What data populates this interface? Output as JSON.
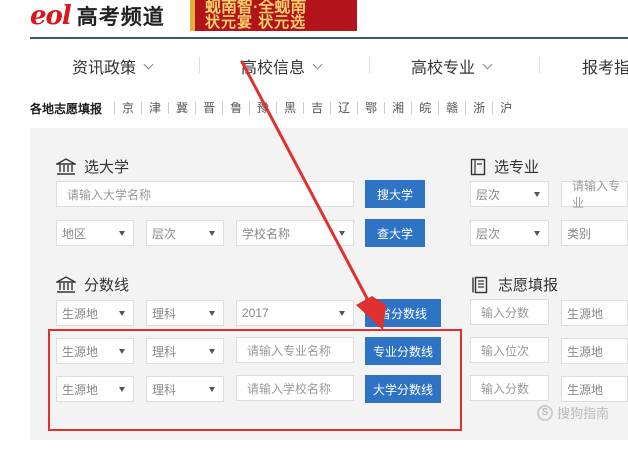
{
  "header": {
    "logo_mark": "eol",
    "logo_title": "高考频道",
    "banner_line1": "蚬南智·全蚬南",
    "banner_line2": "状元宴 状元选"
  },
  "nav": {
    "items": [
      "资讯政策",
      "高校信息",
      "高校专业",
      "报考指"
    ]
  },
  "provinces": {
    "title": "各地志愿填报",
    "items": [
      "京",
      "津",
      "冀",
      "晋",
      "鲁",
      "豫",
      "黑",
      "吉",
      "辽",
      "鄂",
      "湘",
      "皖",
      "赣",
      "浙",
      "沪"
    ]
  },
  "select_university": {
    "title": "选大学",
    "name_placeholder": "请输入大学名称",
    "search_button": "搜大学",
    "region": "地区",
    "level": "层次",
    "school_name": "学校名称",
    "find_button": "查大学"
  },
  "select_major": {
    "title": "选专业",
    "level1": "层次",
    "major_placeholder": "请输入专业",
    "level2": "层次",
    "category": "类别"
  },
  "score_line": {
    "title": "分数线",
    "rows": [
      {
        "origin": "生源地",
        "subject": "理科",
        "third": "2017",
        "button": "省分数线"
      },
      {
        "origin": "生源地",
        "subject": "理科",
        "third": "请输入专业名称",
        "button": "专业分数线"
      },
      {
        "origin": "生源地",
        "subject": "理科",
        "third": "请输入学校名称",
        "button": "大学分数线"
      }
    ]
  },
  "volunteer": {
    "title": "志愿填报",
    "rows": [
      {
        "input": "输入分数",
        "origin": "生源地"
      },
      {
        "input": "输入位次",
        "origin": "生源地"
      },
      {
        "input": "输入分数",
        "origin": "生源地"
      }
    ]
  },
  "watermark": "搜狗指南",
  "colors": {
    "button_blue": "#2e73c4",
    "brand_red": "#d6181f",
    "annotation_red": "#e03030"
  }
}
